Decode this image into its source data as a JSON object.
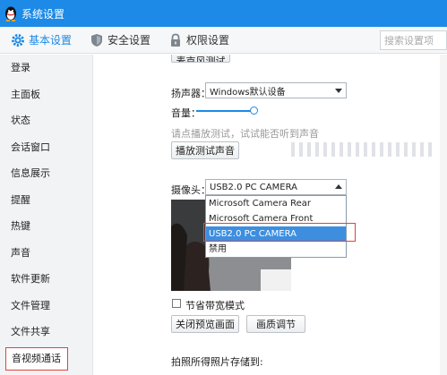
{
  "window": {
    "title": "系统设置"
  },
  "toolbar": {
    "tabs": [
      {
        "label": "基本设置",
        "icon": "gear-icon",
        "active": true
      },
      {
        "label": "安全设置",
        "icon": "shield-icon",
        "active": false
      },
      {
        "label": "权限设置",
        "icon": "lock-icon",
        "active": false
      }
    ],
    "search_placeholder": "搜索设置项"
  },
  "sidebar": {
    "items": [
      {
        "label": "登录"
      },
      {
        "label": "主面板"
      },
      {
        "label": "状态"
      },
      {
        "label": "会话窗口"
      },
      {
        "label": "信息展示"
      },
      {
        "label": "提醒"
      },
      {
        "label": "热键"
      },
      {
        "label": "声音"
      },
      {
        "label": "软件更新"
      },
      {
        "label": "文件管理"
      },
      {
        "label": "文件共享"
      },
      {
        "label": "音视频通话"
      }
    ],
    "active_index": 11
  },
  "audio": {
    "top_button_partial": "麦克风测试",
    "speaker_label": "扬声器：",
    "speaker_value": "Windows默认设备",
    "volume_label": "音量：",
    "volume_level": 0.8,
    "hint": "请点播放测试，试试能否听到声音",
    "play_button": "播放测试声音"
  },
  "camera": {
    "label": "摄像头：",
    "selected": "USB2.0 PC CAMERA",
    "options": [
      "Microsoft Camera Rear",
      "Microsoft Camera Front",
      "USB2.0 PC CAMERA",
      "禁用"
    ],
    "highlighted_index": 2,
    "bandwidth_label": "节省带宽模式",
    "bandwidth_checked": false,
    "close_preview_button": "关闭预览画面",
    "picture_adjust_button": "画质调节"
  },
  "photo": {
    "save_label": "拍照所得照片存储到:"
  },
  "colors": {
    "titlebar": "#1c8ae6",
    "accent": "#1c8ae6",
    "highlight_outline": "#e4403e",
    "selected_option": "#3e8ee0"
  }
}
